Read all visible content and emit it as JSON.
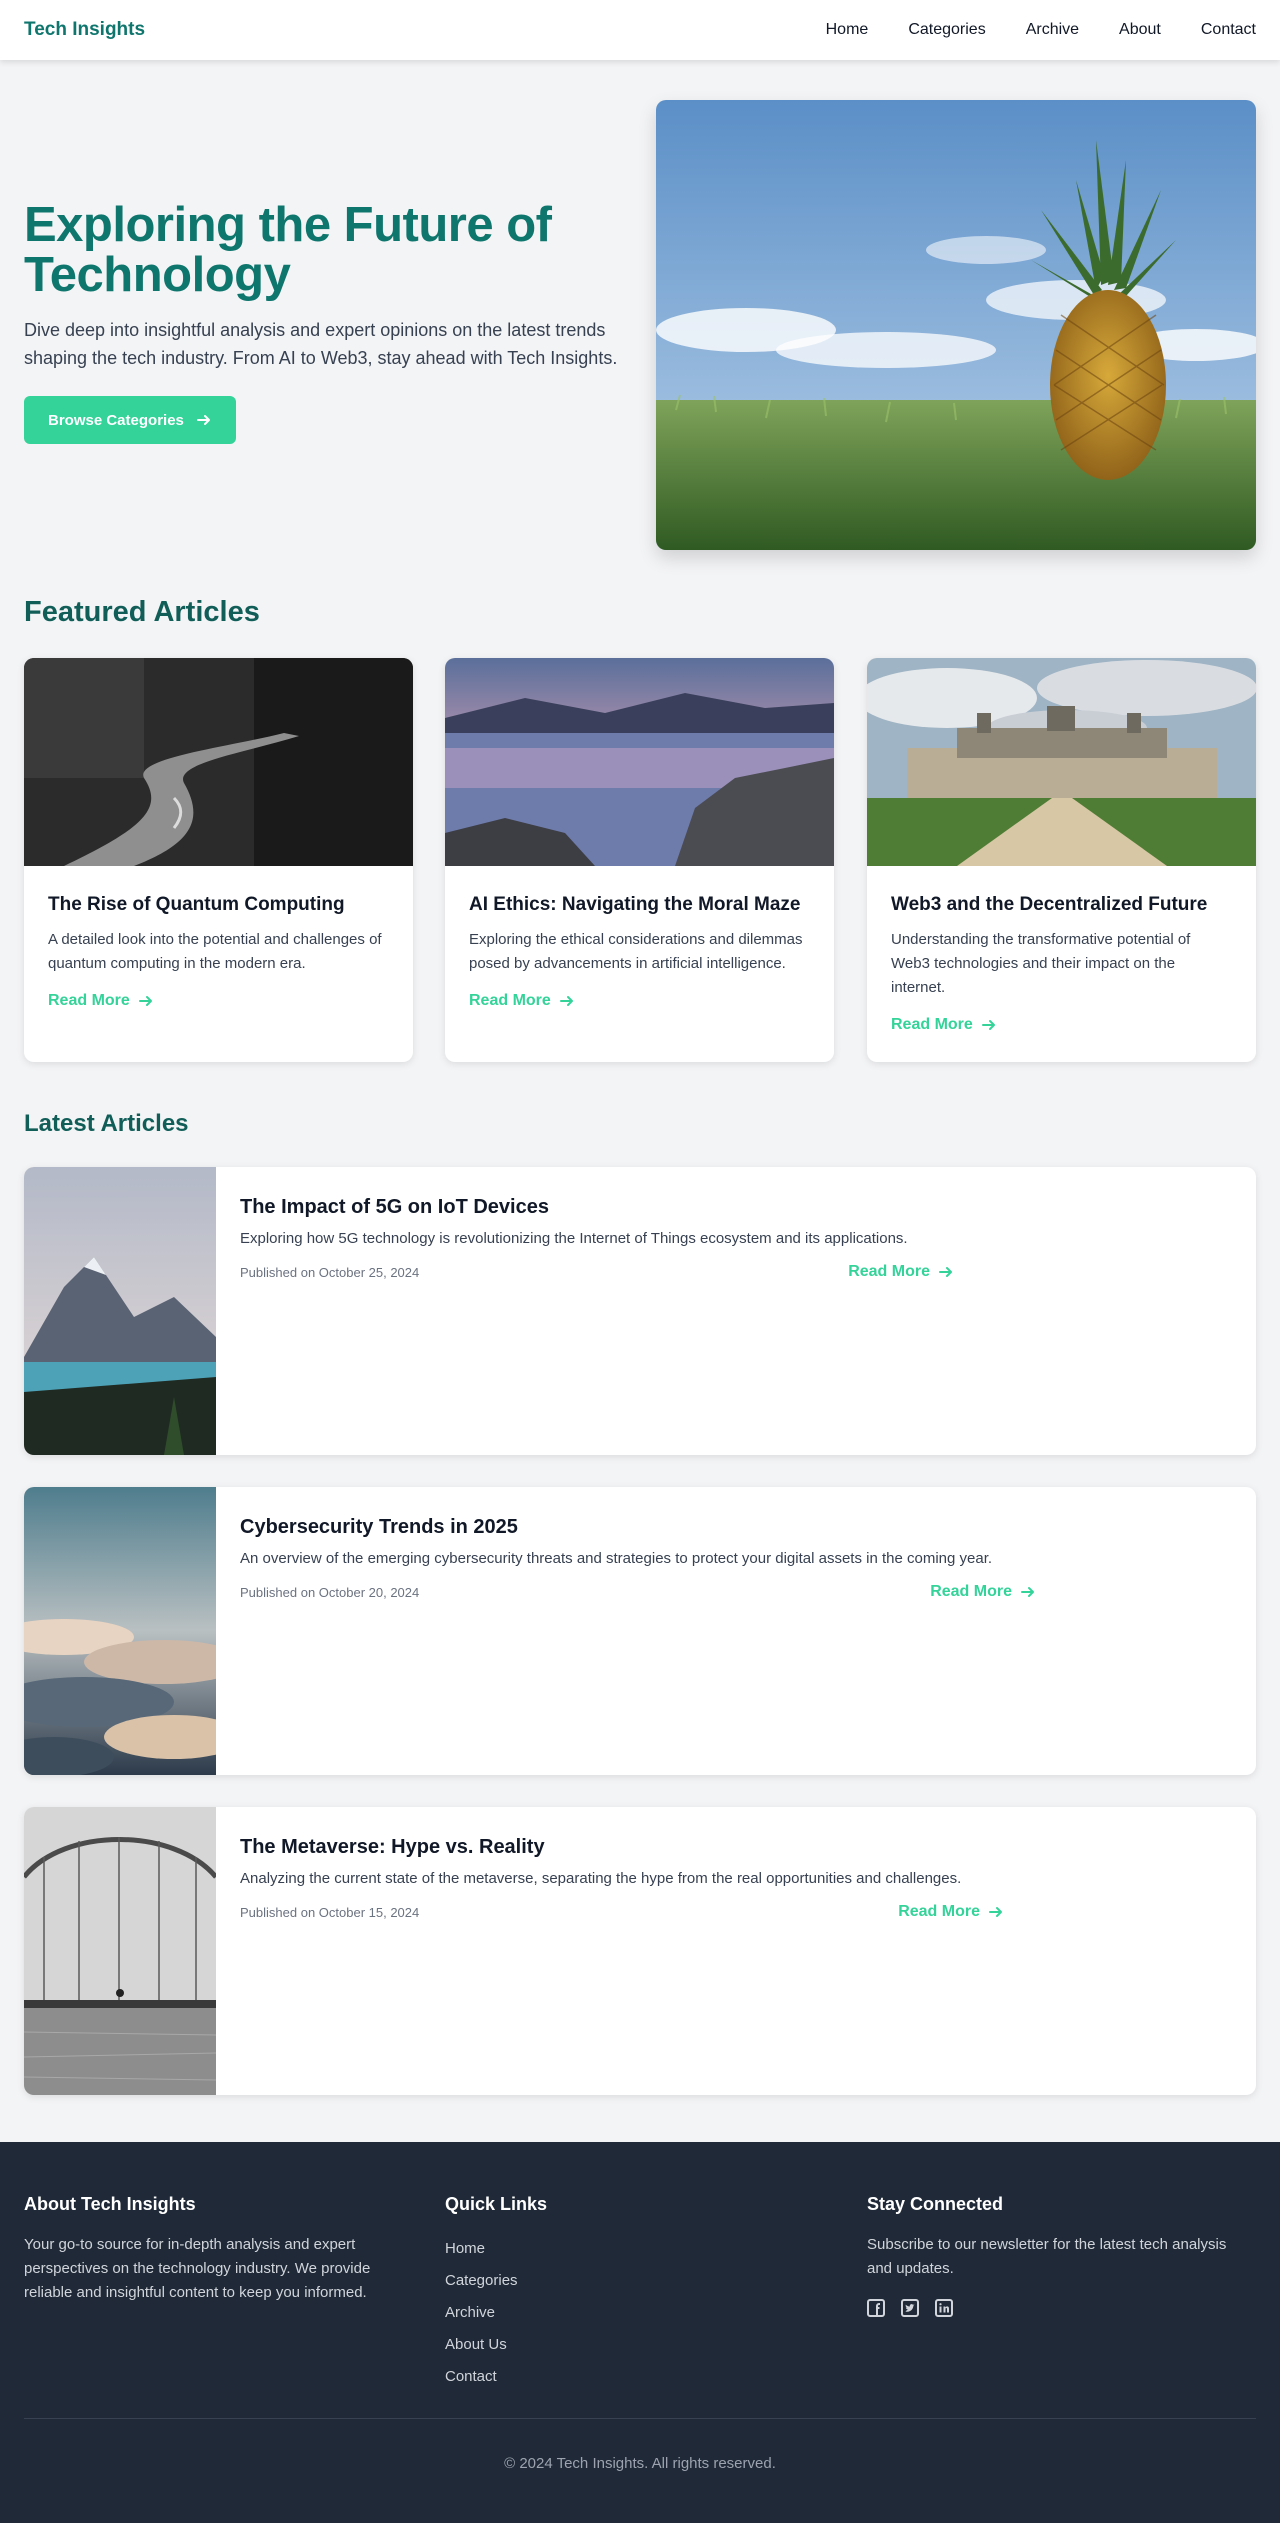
{
  "nav": {
    "brand": "Tech Insights",
    "links": [
      "Home",
      "Categories",
      "Archive",
      "About",
      "Contact"
    ]
  },
  "hero": {
    "title": "Exploring the Future of Technology",
    "subtitle": "Dive deep into insightful analysis and expert opinions on the latest trends shaping the tech industry. From AI to Web3, stay ahead with Tech Insights.",
    "button_label": "Browse Categories",
    "button_icon": "arrow-right-icon"
  },
  "featured": {
    "heading": "Featured Articles",
    "cards": [
      {
        "title": "The Rise of Quantum Computing",
        "description": "A detailed look into the potential and challenges of quantum computing in the modern era.",
        "link_label": "Read More"
      },
      {
        "title": "AI Ethics: Navigating the Moral Maze",
        "description": "Exploring the ethical considerations and dilemmas posed by advancements in artificial intelligence.",
        "link_label": "Read More"
      },
      {
        "title": "Web3 and the Decentralized Future",
        "description": "Understanding the transformative potential of Web3 technologies and their impact on the internet.",
        "link_label": "Read More"
      }
    ]
  },
  "latest": {
    "heading": "Latest Articles",
    "articles": [
      {
        "title": "The Impact of 5G on IoT Devices",
        "description": "Exploring how 5G technology is revolutionizing the Internet of Things ecosystem and its applications.",
        "date": "Published on October 25, 2024",
        "link_label": "Read More"
      },
      {
        "title": "Cybersecurity Trends in 2025",
        "description": "An overview of the emerging cybersecurity threats and strategies to protect your digital assets in the coming year.",
        "date": "Published on October 20, 2024",
        "link_label": "Read More"
      },
      {
        "title": "The Metaverse: Hype vs. Reality",
        "description": "Analyzing the current state of the metaverse, separating the hype from the real opportunities and challenges.",
        "date": "Published on October 15, 2024",
        "link_label": "Read More"
      }
    ]
  },
  "footer": {
    "about": {
      "heading": "About Tech Insights",
      "text": "Your go-to source for in-depth analysis and expert perspectives on the technology industry. We provide reliable and insightful content to keep you informed."
    },
    "quick_links": {
      "heading": "Quick Links",
      "items": [
        "Home",
        "Categories",
        "Archive",
        "About Us",
        "Contact"
      ]
    },
    "connect": {
      "heading": "Stay Connected",
      "text": "Subscribe to our newsletter for the latest tech analysis and updates.",
      "social_icons": [
        "facebook-icon",
        "twitter-icon",
        "linkedin-icon"
      ]
    },
    "copyright": "© 2024 Tech Insights. All rights reserved."
  },
  "colors": {
    "accent": "#34d399",
    "brand": "#0f766e",
    "footer_bg": "#1f2937",
    "page_bg": "#f3f4f6"
  }
}
